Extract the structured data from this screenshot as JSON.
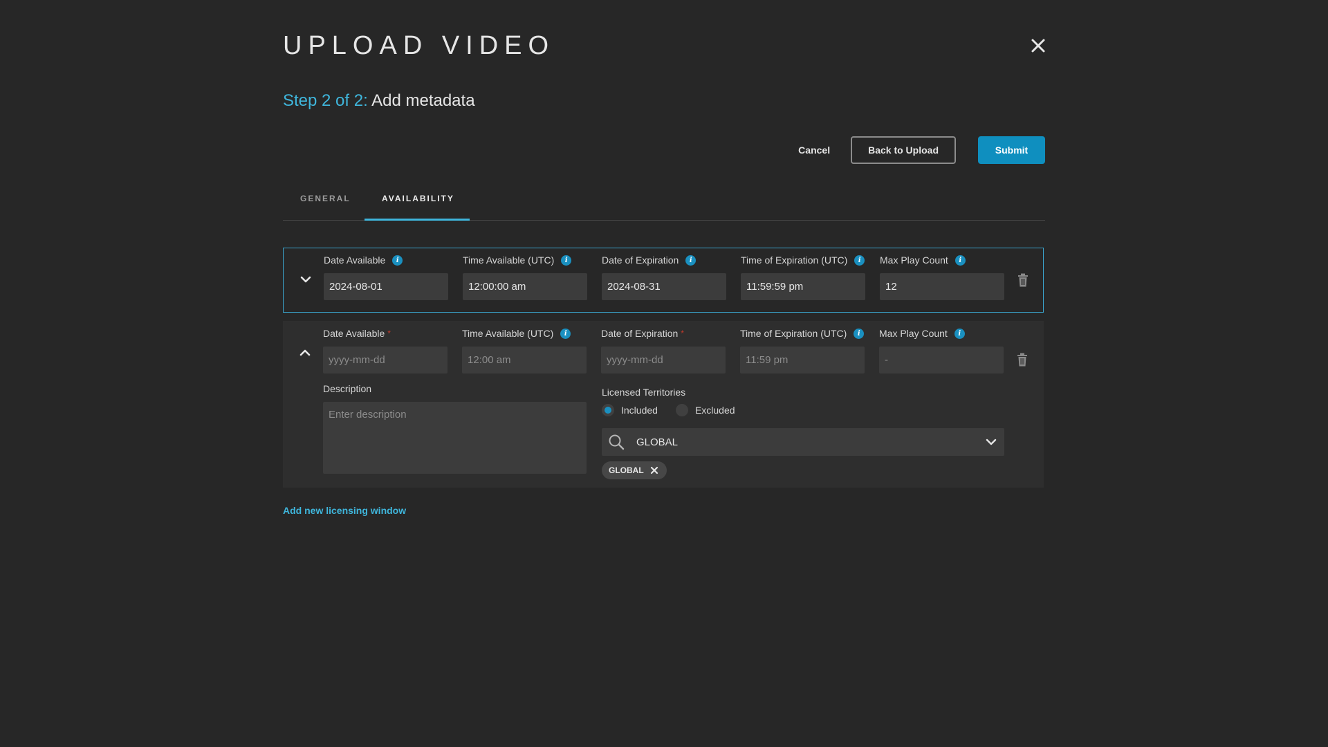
{
  "modal": {
    "title": "UPLOAD VIDEO",
    "step_prefix": "Step 2 of 2:",
    "step_title": "Add metadata"
  },
  "actions": {
    "cancel": "Cancel",
    "back": "Back to Upload",
    "submit": "Submit"
  },
  "tabs": [
    {
      "label": "GENERAL",
      "active": false
    },
    {
      "label": "AVAILABILITY",
      "active": true
    }
  ],
  "windows": [
    {
      "expanded": false,
      "date_available": {
        "label": "Date Available",
        "value": "2024-08-01"
      },
      "time_available": {
        "label": "Time Available (UTC)",
        "value": "12:00:00 am"
      },
      "date_expiration": {
        "label": "Date of Expiration",
        "value": "2024-08-31"
      },
      "time_expiration": {
        "label": "Time of Expiration (UTC)",
        "value": "11:59:59 pm"
      },
      "max_play_count": {
        "label": "Max Play Count",
        "value": "12"
      }
    },
    {
      "expanded": true,
      "date_available": {
        "label": "Date Available",
        "placeholder": "yyyy-mm-dd",
        "required": "*"
      },
      "time_available": {
        "label": "Time Available (UTC)",
        "placeholder": "12:00 am"
      },
      "date_expiration": {
        "label": "Date of Expiration",
        "placeholder": "yyyy-mm-dd",
        "required": "*"
      },
      "time_expiration": {
        "label": "Time of Expiration (UTC)",
        "placeholder": "11:59 pm"
      },
      "max_play_count": {
        "label": "Max Play Count",
        "placeholder": "-"
      },
      "description": {
        "label": "Description",
        "placeholder": "Enter description"
      },
      "territories": {
        "label": "Licensed Territories",
        "options": [
          "Included",
          "Excluded"
        ],
        "selected": "Included",
        "search_value": "GLOBAL",
        "chips": [
          "GLOBAL"
        ]
      }
    }
  ],
  "add_link": "Add new licensing window",
  "colors": {
    "background": "#272727",
    "accent": "#3fb6dc",
    "primary_button": "#0f8fbf",
    "info_icon": "#1a90c0"
  },
  "icons": [
    "close-icon",
    "chevron-down-icon",
    "chevron-up-icon",
    "info-icon",
    "trash-icon",
    "search-icon",
    "dropdown-chevron-icon",
    "chip-remove-icon"
  ]
}
